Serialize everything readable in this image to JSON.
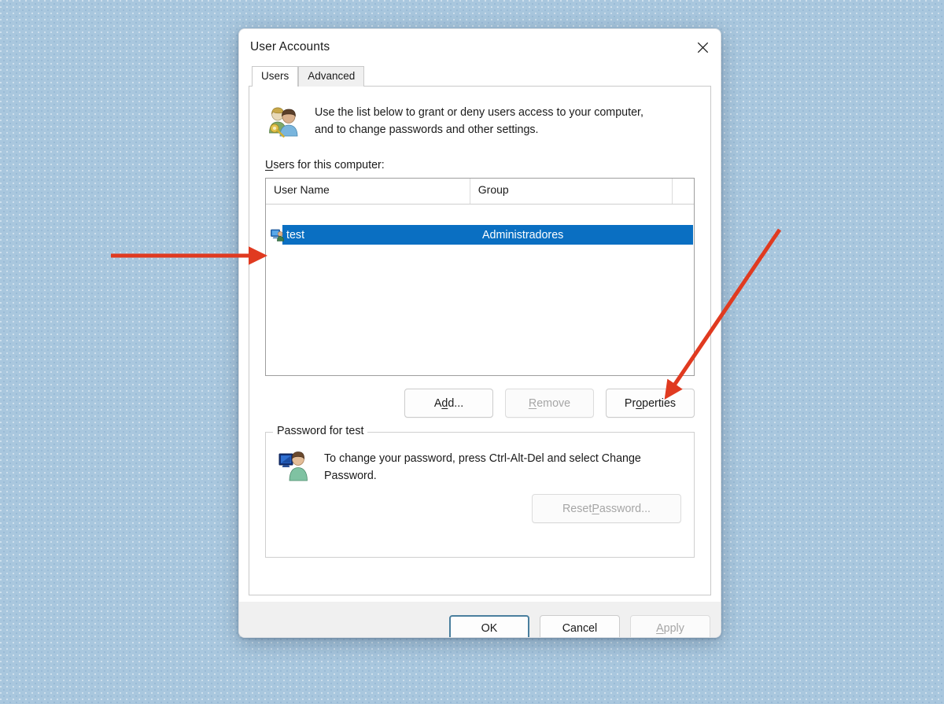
{
  "window": {
    "title": "User Accounts",
    "close_icon": "close-icon"
  },
  "tabs": [
    {
      "label": "Users",
      "active": true
    },
    {
      "label": "Advanced",
      "active": false
    }
  ],
  "intro": {
    "icon": "users-key-icon",
    "text": "Use the list below to grant or deny users access to your computer, and to change passwords and other settings."
  },
  "list": {
    "label_prefix": "U",
    "label_rest": "sers for this computer:",
    "columns": [
      "User Name",
      "Group",
      ""
    ],
    "rows": [
      {
        "icon": "user-computer-icon",
        "name": "test",
        "group": "Administradores",
        "selected": true
      }
    ]
  },
  "list_actions": [
    {
      "name": "add-button",
      "pre": "A",
      "key": "d",
      "post": "d...",
      "disabled": false
    },
    {
      "name": "remove-button",
      "pre": "",
      "key": "R",
      "post": "emove",
      "disabled": true
    },
    {
      "name": "properties-button",
      "pre": "Pr",
      "key": "o",
      "post": "perties",
      "disabled": false
    }
  ],
  "password_group": {
    "legend": "Password for test",
    "icon": "user-monitor-icon",
    "text": "To change your password, press Ctrl-Alt-Del and select Change Password.",
    "reset_button": {
      "pre": "Reset ",
      "key": "P",
      "post": "assword...",
      "disabled": true
    }
  },
  "footer_buttons": [
    {
      "name": "ok-button",
      "pre": "OK",
      "key": "",
      "post": "",
      "disabled": false,
      "default": true
    },
    {
      "name": "cancel-button",
      "pre": "Cancel",
      "key": "",
      "post": "",
      "disabled": false,
      "default": false
    },
    {
      "name": "apply-button",
      "pre": "",
      "key": "A",
      "post": "pply",
      "disabled": true,
      "default": false
    }
  ],
  "annotations": {
    "arrow_color": "#e03a20",
    "arrows": [
      {
        "name": "arrow-to-user-row",
        "from": [
          141,
          325
        ],
        "to": [
          338,
          325
        ]
      },
      {
        "name": "arrow-to-properties-button",
        "from": [
          991,
          292
        ],
        "to": [
          841,
          513
        ]
      }
    ]
  },
  "colors": {
    "selection_blue": "#0a6fc2",
    "desktop_blue": "#a9c7de",
    "default_button_border": "#4a7f9e"
  }
}
